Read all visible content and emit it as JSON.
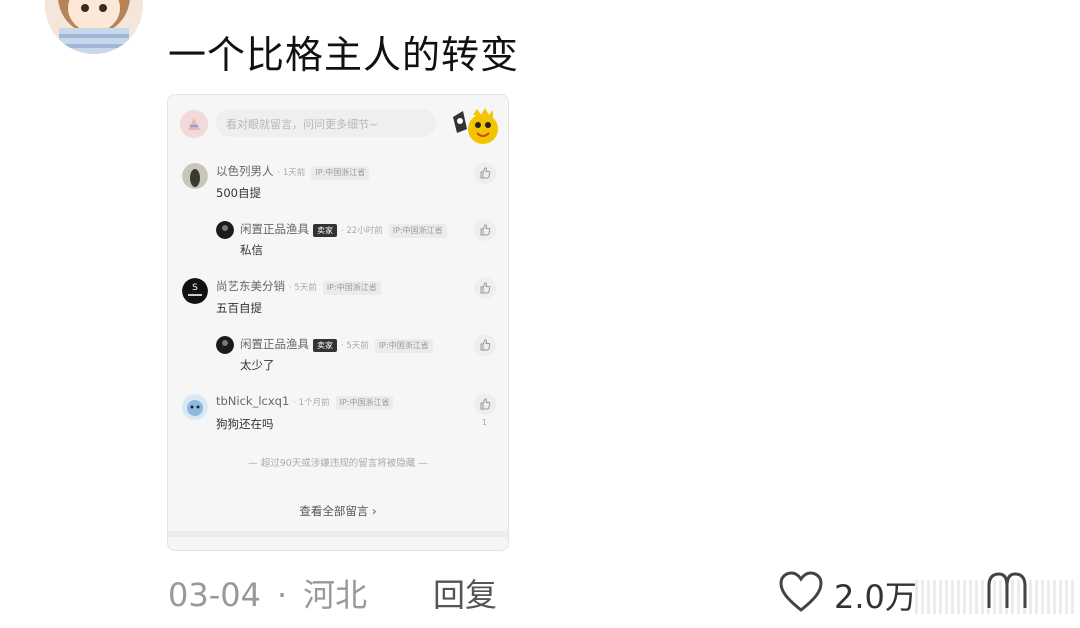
{
  "comment": {
    "text": "一个比格主人的转变",
    "date": "03-04",
    "location": "河北",
    "separator": "·",
    "reply_label": "回复",
    "like_count": "2.0万"
  },
  "screenshot": {
    "search_placeholder": "看对眼就留言，问问更多细节~",
    "rows": [
      {
        "name": "以色列男人",
        "time": "· 1天前",
        "ip": "IP:中国浙江省",
        "text": "500自提"
      },
      {
        "name": "闲置正品渔具",
        "badge": "卖家",
        "time": "· 22小时前",
        "ip": "IP:中国浙江省",
        "text": "私信"
      },
      {
        "name": "尚艺东美分销",
        "time": "· 5天前",
        "ip": "IP:中国浙江省",
        "text": "五百自提"
      },
      {
        "name": "闲置正品渔具",
        "badge": "卖家",
        "time": "· 5天前",
        "ip": "IP:中国浙江省",
        "text": "太少了"
      },
      {
        "name": "tbNick_lcxq1",
        "time": "· 1个月前",
        "ip": "IP:中国浙江省",
        "text": "狗狗还在吗",
        "like_count": "1"
      }
    ],
    "hidden_notice": "— 超过90天或涉嫌违规的留言将被隐藏 —",
    "view_all": "查看全部留言 ›"
  },
  "colors": {
    "accent_yellow": "#f5c400",
    "muted": "#999999"
  }
}
